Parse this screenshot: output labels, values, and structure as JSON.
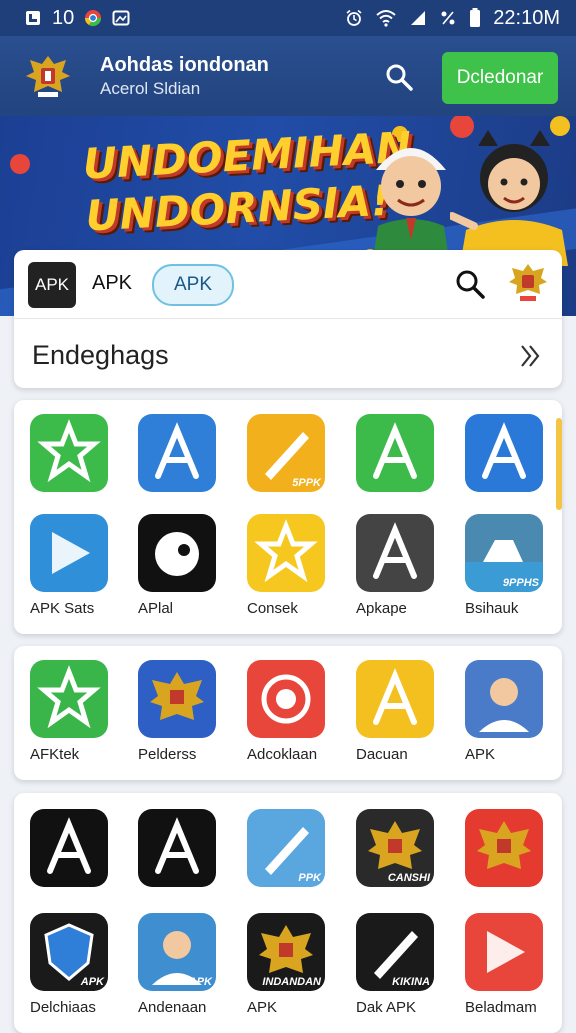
{
  "status_bar": {
    "left_value": "10",
    "time": "22:10M"
  },
  "header": {
    "title": "Aohdas iondonan",
    "subtitle": "Acerol Sldian",
    "download_button": "Dcledonar"
  },
  "banner": {
    "line1": "UNDOEMIHAN",
    "line2": "UNDORNSIA!"
  },
  "search_card": {
    "apk_tile": "APK",
    "apk_label": "APK",
    "apk_pill": "APK",
    "section_title": "Endeghags"
  },
  "app_sections": [
    {
      "apps": [
        {
          "name": "",
          "icon": "green-star-app-icon",
          "color": "#3cba4a"
        },
        {
          "name": "",
          "icon": "blue-a-app-icon",
          "color": "#2f7fd8"
        },
        {
          "name": "",
          "icon": "pen-tool-app-icon",
          "color": "#f2b01c",
          "badge": "5PPK"
        },
        {
          "name": "",
          "icon": "green-a-circle-app-icon",
          "color": "#3cba4a"
        },
        {
          "name": "",
          "icon": "blue-green-a-app-icon",
          "color": "#2a78d8"
        },
        {
          "name": "APK Sats",
          "icon": "play-arrow-app-icon",
          "color": "#2f8fd8"
        },
        {
          "name": "APlal",
          "icon": "bird-app-icon",
          "color": "#111111"
        },
        {
          "name": "Consek",
          "icon": "yellow-star-app-icon",
          "color": "#f6c81f"
        },
        {
          "name": "Apkape",
          "icon": "gray-a-app-icon",
          "color": "#444444"
        },
        {
          "name": "Bsihauk",
          "icon": "landscape-photo-app-icon",
          "color": "#4a8ab0",
          "badge": "9PPHS"
        }
      ]
    },
    {
      "apps": [
        {
          "name": "AFKtek",
          "icon": "green-star-arrow-app-icon",
          "color": "#39b54a"
        },
        {
          "name": "Pelderss",
          "icon": "seal-app-icon",
          "color": "#2d5fc4"
        },
        {
          "name": "Adcoklaan",
          "icon": "circle-ring-app-icon",
          "color": "#e8463a"
        },
        {
          "name": "Dacuan",
          "icon": "garuda-app-icon",
          "color": "#f4c020"
        },
        {
          "name": "APK",
          "icon": "portrait-app-icon",
          "color": "#4a7bc8"
        }
      ]
    },
    {
      "apps": [
        {
          "name": "",
          "icon": "black-a-red-app-icon",
          "color": "#111111"
        },
        {
          "name": "",
          "icon": "black-a-app-icon",
          "color": "#111111"
        },
        {
          "name": "",
          "icon": "pen-blue-app-icon",
          "color": "#5aa7e0",
          "badge": "PPK"
        },
        {
          "name": "",
          "icon": "statue-app-icon",
          "color": "#2a2a2a",
          "badge": "CANSHI"
        },
        {
          "name": "",
          "icon": "red-emblem-app-icon",
          "color": "#e53a2f"
        },
        {
          "name": "Delchiaas",
          "icon": "shield-app-icon",
          "color": "#1a1a1a",
          "badge": "APK"
        },
        {
          "name": "Andenaan",
          "icon": "cartoon-person-app-icon",
          "color": "#3f8fd0",
          "badge": "APK"
        },
        {
          "name": "APK",
          "icon": "garuda-black-app-icon",
          "color": "#1a1a1a",
          "badge": "INDANDAN"
        },
        {
          "name": "Dak APK",
          "icon": "pencil-app-icon",
          "color": "#1a1a1a",
          "badge": "KIKINA"
        },
        {
          "name": "Beladmam",
          "icon": "colorful-play-app-icon",
          "color": "#e8463a"
        }
      ]
    }
  ]
}
